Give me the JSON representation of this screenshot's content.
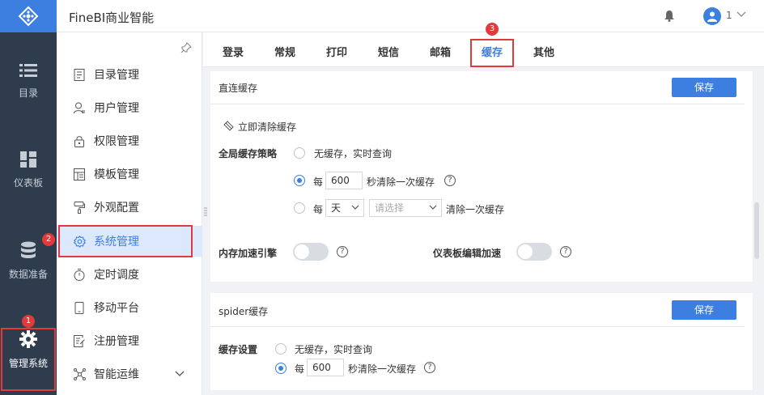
{
  "header": {
    "app_title": "FineBI商业智能",
    "user_name": "1"
  },
  "rail": [
    {
      "label": "目录",
      "icon": "list-icon"
    },
    {
      "label": "仪表板",
      "icon": "dashboard-icon"
    },
    {
      "label": "数据准备",
      "icon": "database-icon"
    },
    {
      "label": "管理系统",
      "icon": "gear-icon"
    }
  ],
  "menu": [
    {
      "label": "目录管理"
    },
    {
      "label": "用户管理"
    },
    {
      "label": "权限管理"
    },
    {
      "label": "模板管理"
    },
    {
      "label": "外观配置"
    },
    {
      "label": "系统管理"
    },
    {
      "label": "定时调度"
    },
    {
      "label": "移动平台"
    },
    {
      "label": "注册管理"
    },
    {
      "label": "智能运维"
    }
  ],
  "tabs": [
    "登录",
    "常规",
    "打印",
    "短信",
    "邮箱",
    "缓存",
    "其他"
  ],
  "badges": [
    "1",
    "2",
    "3"
  ],
  "direct_cache": {
    "title": "直连缓存",
    "save_label": "保存",
    "clear_label": "立即清除缓存",
    "strategy_label": "全局缓存策略",
    "option_none": "无缓存，实时查询",
    "option_every": "每",
    "seconds_value": "600",
    "seconds_suffix": "秒清除一次缓存",
    "day_unit": "天",
    "select_placeholder": "请选择",
    "clear_once": "清除一次缓存",
    "memory_accel_label": "内存加速引擎",
    "dashboard_accel_label": "仪表板编辑加速"
  },
  "spider_cache": {
    "title": "spider缓存",
    "save_label": "保存",
    "setting_label": "缓存设置",
    "option_none": "无缓存，实时查询",
    "option_every": "每",
    "seconds_value": "600",
    "seconds_suffix": "秒清除一次缓存"
  },
  "colors": {
    "accent": "#3d7fe0",
    "rail_bg": "#2f3c4e",
    "highlight": "#e03a3a"
  }
}
